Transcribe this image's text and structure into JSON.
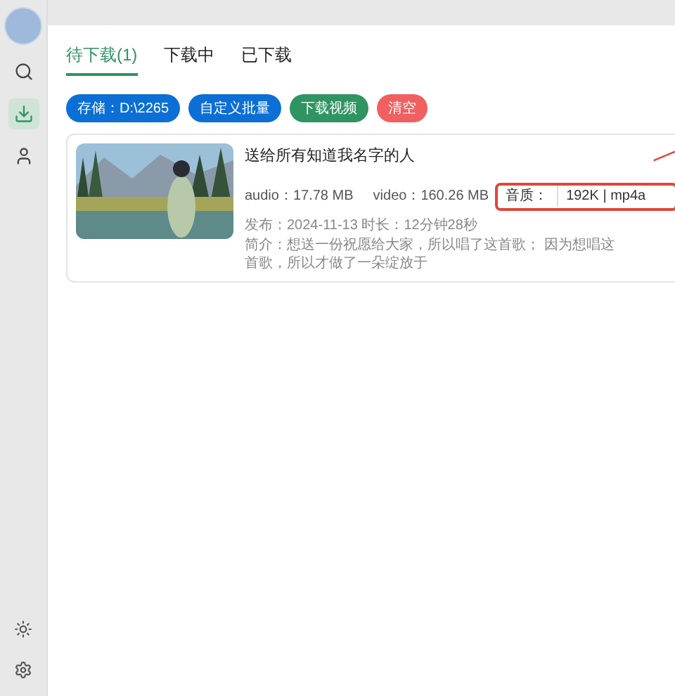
{
  "sidebar": {
    "items": [
      {
        "kind": "search",
        "selected": false
      },
      {
        "kind": "download",
        "selected": true
      },
      {
        "kind": "user",
        "selected": false
      }
    ],
    "bottom": [
      {
        "kind": "theme"
      },
      {
        "kind": "settings"
      }
    ]
  },
  "tabs": [
    {
      "label": "待下载(1)",
      "selected": true
    },
    {
      "label": "下载中",
      "selected": false
    },
    {
      "label": "已下载",
      "selected": false
    }
  ],
  "buttons": [
    {
      "label": "存储：D:\\2265",
      "color": "#0b6fd6"
    },
    {
      "label": "自定义批量",
      "color": "#0b6fd6"
    },
    {
      "label": "下载视频",
      "color": "#2f9461"
    },
    {
      "label": "清空",
      "color": "#f06060"
    }
  ],
  "items": [
    {
      "kind": "picture",
      "title": "送给所有知道我名字的人",
      "audio": "audio：17.78 MB",
      "video": "video：160.26 MB",
      "quality_label": "音质：",
      "quality_value": "192K | mp4a",
      "meta": "发布：2024-11-13 时长：12分钟28秒",
      "intro": "简介：想送一份祝愿给大家，所以唱了这首歌； 因为想唱这首歌，所以才做了一朵绽放于"
    }
  ]
}
